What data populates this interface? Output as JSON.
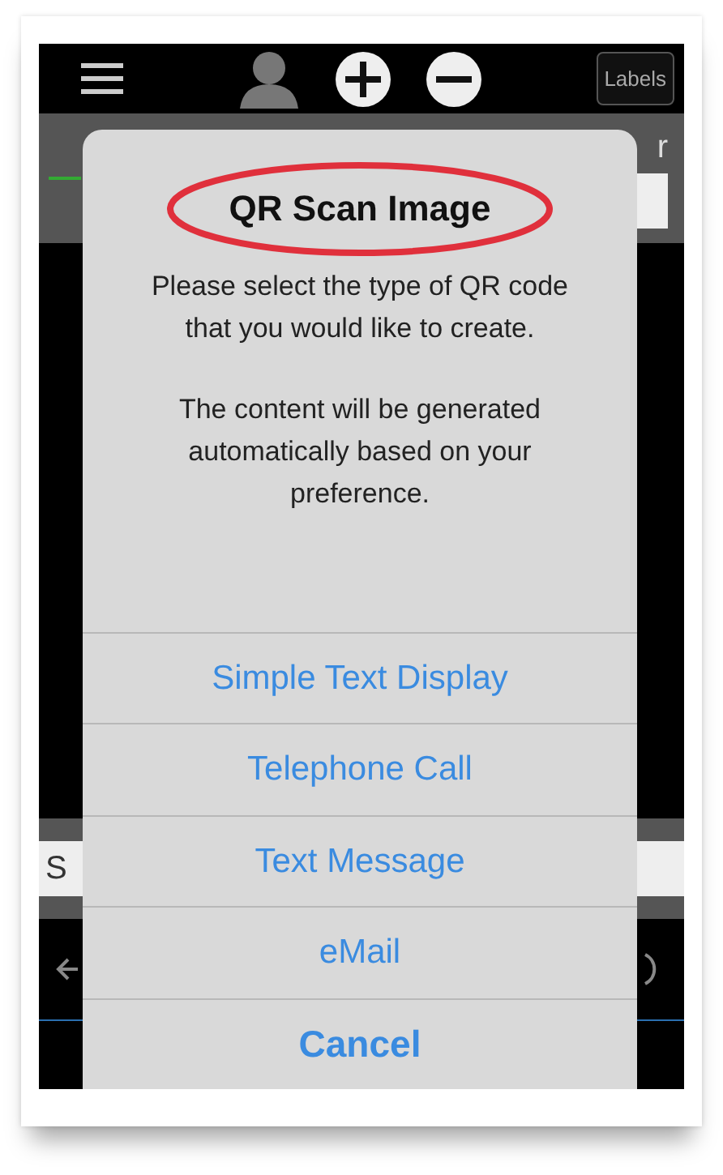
{
  "toolbar": {
    "labels_button": "Labels"
  },
  "background": {
    "right_fragment": "r",
    "left_fragment": "S"
  },
  "dialog": {
    "title": "QR Scan Image",
    "message_lines": [
      "Please select the type of QR code that you would like to create.",
      "The content will be generated automatically based on your preference."
    ],
    "actions": [
      {
        "label": "Simple Text Display",
        "kind": "default"
      },
      {
        "label": "Telephone Call",
        "kind": "default"
      },
      {
        "label": "Text Message",
        "kind": "default"
      },
      {
        "label": "eMail",
        "kind": "default"
      },
      {
        "label": "Cancel",
        "kind": "cancel"
      }
    ]
  },
  "annotation": {
    "kind": "ellipse",
    "color": "#e0303c"
  }
}
